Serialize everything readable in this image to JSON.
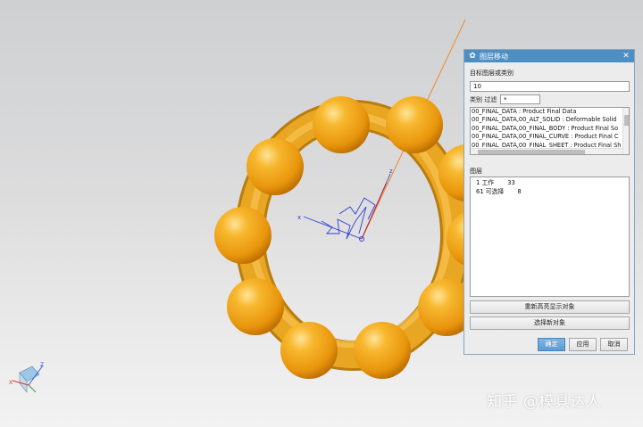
{
  "dialog": {
    "title": "图层移动",
    "target_label": "目标图层或类别",
    "target_value": "10",
    "category_filter_label": "类别 过滤",
    "category_filter_value": "*",
    "categories": [
      "00_FINAL_DATA : Product Final Data",
      "00_FINAL_DATA,00_ALT_SOLID : Deformable Solid",
      "00_FINAL_DATA,00_FINAL_BODY : Product Final So",
      "00_FINAL_DATA,00_FINAL_CURVE : Product Final C",
      "00_FINAL_DATA,00_FINAL_SHEET : Product Final Sh"
    ],
    "layer_label": "图层",
    "layers": [
      "1 工作       33",
      "61 可选择       8"
    ],
    "reselect_label": "重新高亮显示对象",
    "select_new_label": "选择新对象",
    "ok_label": "确定",
    "apply_label": "应用",
    "cancel_label": "取消"
  },
  "watermark": "知乎 @模具达人",
  "colors": {
    "dialog_title_bar": "#4d8fc4",
    "sphere": "#f2a41c",
    "ring": "#e7a21f",
    "primary_button": "#5b9bd2",
    "datum_line": "#f08a2a"
  },
  "icons": {
    "dialog_icon": "gear-icon",
    "close": "close-icon"
  }
}
